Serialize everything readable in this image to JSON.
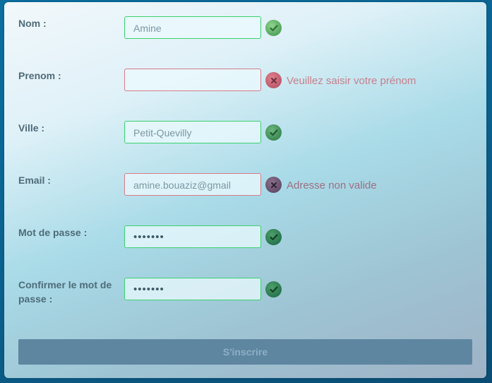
{
  "form": {
    "fields": [
      {
        "label": "Nom :",
        "value": "Amine",
        "status": "valid",
        "message": ""
      },
      {
        "label": "Prenom :",
        "value": "",
        "status": "invalid",
        "message": "Veuillez saisir votre prénom"
      },
      {
        "label": "Ville :",
        "value": "Petit-Quevilly",
        "status": "valid",
        "message": ""
      },
      {
        "label": "Email :",
        "value": "amine.bouaziz@gmail",
        "status": "invalid",
        "message": "Adresse non valide"
      },
      {
        "label": "Mot de passe :",
        "value": "•••••••",
        "status": "valid",
        "message": ""
      },
      {
        "label": "Confirmer le mot de passe :",
        "value": "•••••••",
        "status": "valid",
        "message": ""
      }
    ],
    "submit_label": "S'inscrire"
  },
  "colors": {
    "valid_border": "#3ad16f",
    "invalid_border": "#d77c88",
    "button_bg": "#5e86a0"
  },
  "icons": {
    "valid": "checkmark-icon",
    "invalid": "cross-icon"
  }
}
